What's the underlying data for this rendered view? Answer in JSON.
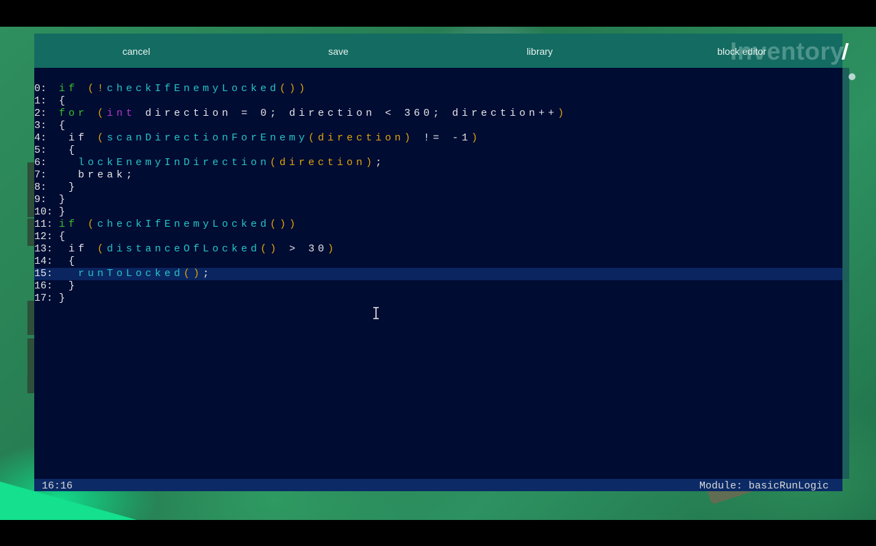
{
  "toolbar": {
    "cancel_label": "cancel",
    "save_label": "save",
    "library_label": "library",
    "block_editor_label": "block editor"
  },
  "background": {
    "inventory_title": "Inventory"
  },
  "code_lines": [
    [
      {
        "t": "if ",
        "c": "kw"
      },
      {
        "t": "(!",
        "c": "pa"
      },
      {
        "t": "checkIfEnemyLocked",
        "c": "fn"
      },
      {
        "t": "())",
        "c": "pa"
      }
    ],
    [
      {
        "t": "{",
        "c": "pl"
      }
    ],
    [
      {
        "t": "for ",
        "c": "kw"
      },
      {
        "t": "(",
        "c": "pa"
      },
      {
        "t": "int",
        "c": "ty"
      },
      {
        "t": " direction = 0; direction < 360; direction++",
        "c": "pl"
      },
      {
        "t": ")",
        "c": "pa"
      }
    ],
    [
      {
        "t": "{",
        "c": "pl"
      }
    ],
    [
      {
        "t": " if ",
        "c": "pl"
      },
      {
        "t": "(",
        "c": "pa"
      },
      {
        "t": "scanDirectionForEnemy",
        "c": "fn"
      },
      {
        "t": "(direction)",
        "c": "pa"
      },
      {
        "t": " != -1",
        "c": "pl"
      },
      {
        "t": ")",
        "c": "pa"
      }
    ],
    [
      {
        "t": " {",
        "c": "pl"
      }
    ],
    [
      {
        "t": "  ",
        "c": "pl"
      },
      {
        "t": "lockEnemyInDirection",
        "c": "fn"
      },
      {
        "t": "(direction)",
        "c": "pa"
      },
      {
        "t": ";",
        "c": "pl"
      }
    ],
    [
      {
        "t": "  break;",
        "c": "pl"
      }
    ],
    [
      {
        "t": " }",
        "c": "pl"
      }
    ],
    [
      {
        "t": "}",
        "c": "pl"
      }
    ],
    [
      {
        "t": "}",
        "c": "pl"
      }
    ],
    [
      {
        "t": "if ",
        "c": "kw"
      },
      {
        "t": "(",
        "c": "pa"
      },
      {
        "t": "checkIfEnemyLocked",
        "c": "fn"
      },
      {
        "t": "())",
        "c": "pa"
      }
    ],
    [
      {
        "t": "{",
        "c": "pl"
      }
    ],
    [
      {
        "t": " if ",
        "c": "pl"
      },
      {
        "t": "(",
        "c": "pa"
      },
      {
        "t": "distanceOfLocked",
        "c": "fn"
      },
      {
        "t": "()",
        "c": "pa"
      },
      {
        "t": " > 30",
        "c": "pl"
      },
      {
        "t": ")",
        "c": "pa"
      }
    ],
    [
      {
        "t": " {",
        "c": "pl"
      }
    ],
    [
      {
        "t": "  ",
        "c": "pl"
      },
      {
        "t": "runToLocked",
        "c": "fn"
      },
      {
        "t": "()",
        "c": "pa"
      },
      {
        "t": ";",
        "c": "pl"
      }
    ],
    [
      {
        "t": " }",
        "c": "pl"
      }
    ],
    [
      {
        "t": "}",
        "c": "pl"
      }
    ]
  ],
  "active_line": 15,
  "status": {
    "cursor_position": "16:16",
    "module": "Module: basicRunLogic"
  },
  "colors": {
    "keyword": "#38c22f",
    "type": "#b437c8",
    "function": "#27c3c6",
    "punctuation": "#e0a50a",
    "plain": "#e6e6e6",
    "editor_bg": "#010c33",
    "toolbar_bg": "#136b62"
  },
  "icons": {
    "mouse_cursor": "i-beam-cursor-icon"
  }
}
